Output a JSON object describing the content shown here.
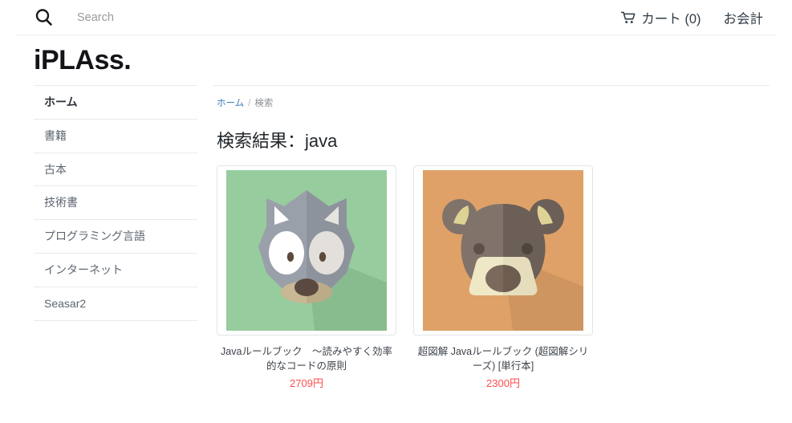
{
  "header": {
    "search": {
      "icon": "search-icon",
      "placeholder": "Search",
      "value": ""
    },
    "nav": [
      {
        "icon": "cart-icon",
        "label": "カート (0)"
      },
      {
        "icon": "",
        "label": "お会計"
      }
    ]
  },
  "brand": {
    "label": "iPLAss."
  },
  "sidebar": {
    "items": [
      {
        "label": "ホーム",
        "active": true
      },
      {
        "label": "書籍",
        "active": false
      },
      {
        "label": "古本",
        "active": false
      },
      {
        "label": "技術書",
        "active": false
      },
      {
        "label": "プログラミング言語",
        "active": false
      },
      {
        "label": "インターネット",
        "active": false
      },
      {
        "label": "Seasar2",
        "active": false
      }
    ]
  },
  "breadcrumb": {
    "home": "ホーム",
    "separator": "/",
    "current": "検索"
  },
  "main": {
    "title": "検索結果：java",
    "products": [
      {
        "image": "wolf-avatar-image",
        "title": "Javaルールブック　～読みやすく効率的なコードの原則",
        "price": "2709円",
        "bg_color": "#97CC9E"
      },
      {
        "image": "bear-avatar-image",
        "title": "超図解 Javaルールブック (超図解シリーズ) [単行本]",
        "price": "2300円",
        "bg_color": "#DFA167"
      }
    ]
  },
  "colors": {
    "link": "#3f7bbf",
    "price": "#ff4d4d",
    "text": "#3d434a",
    "border": "#e8eaec"
  }
}
